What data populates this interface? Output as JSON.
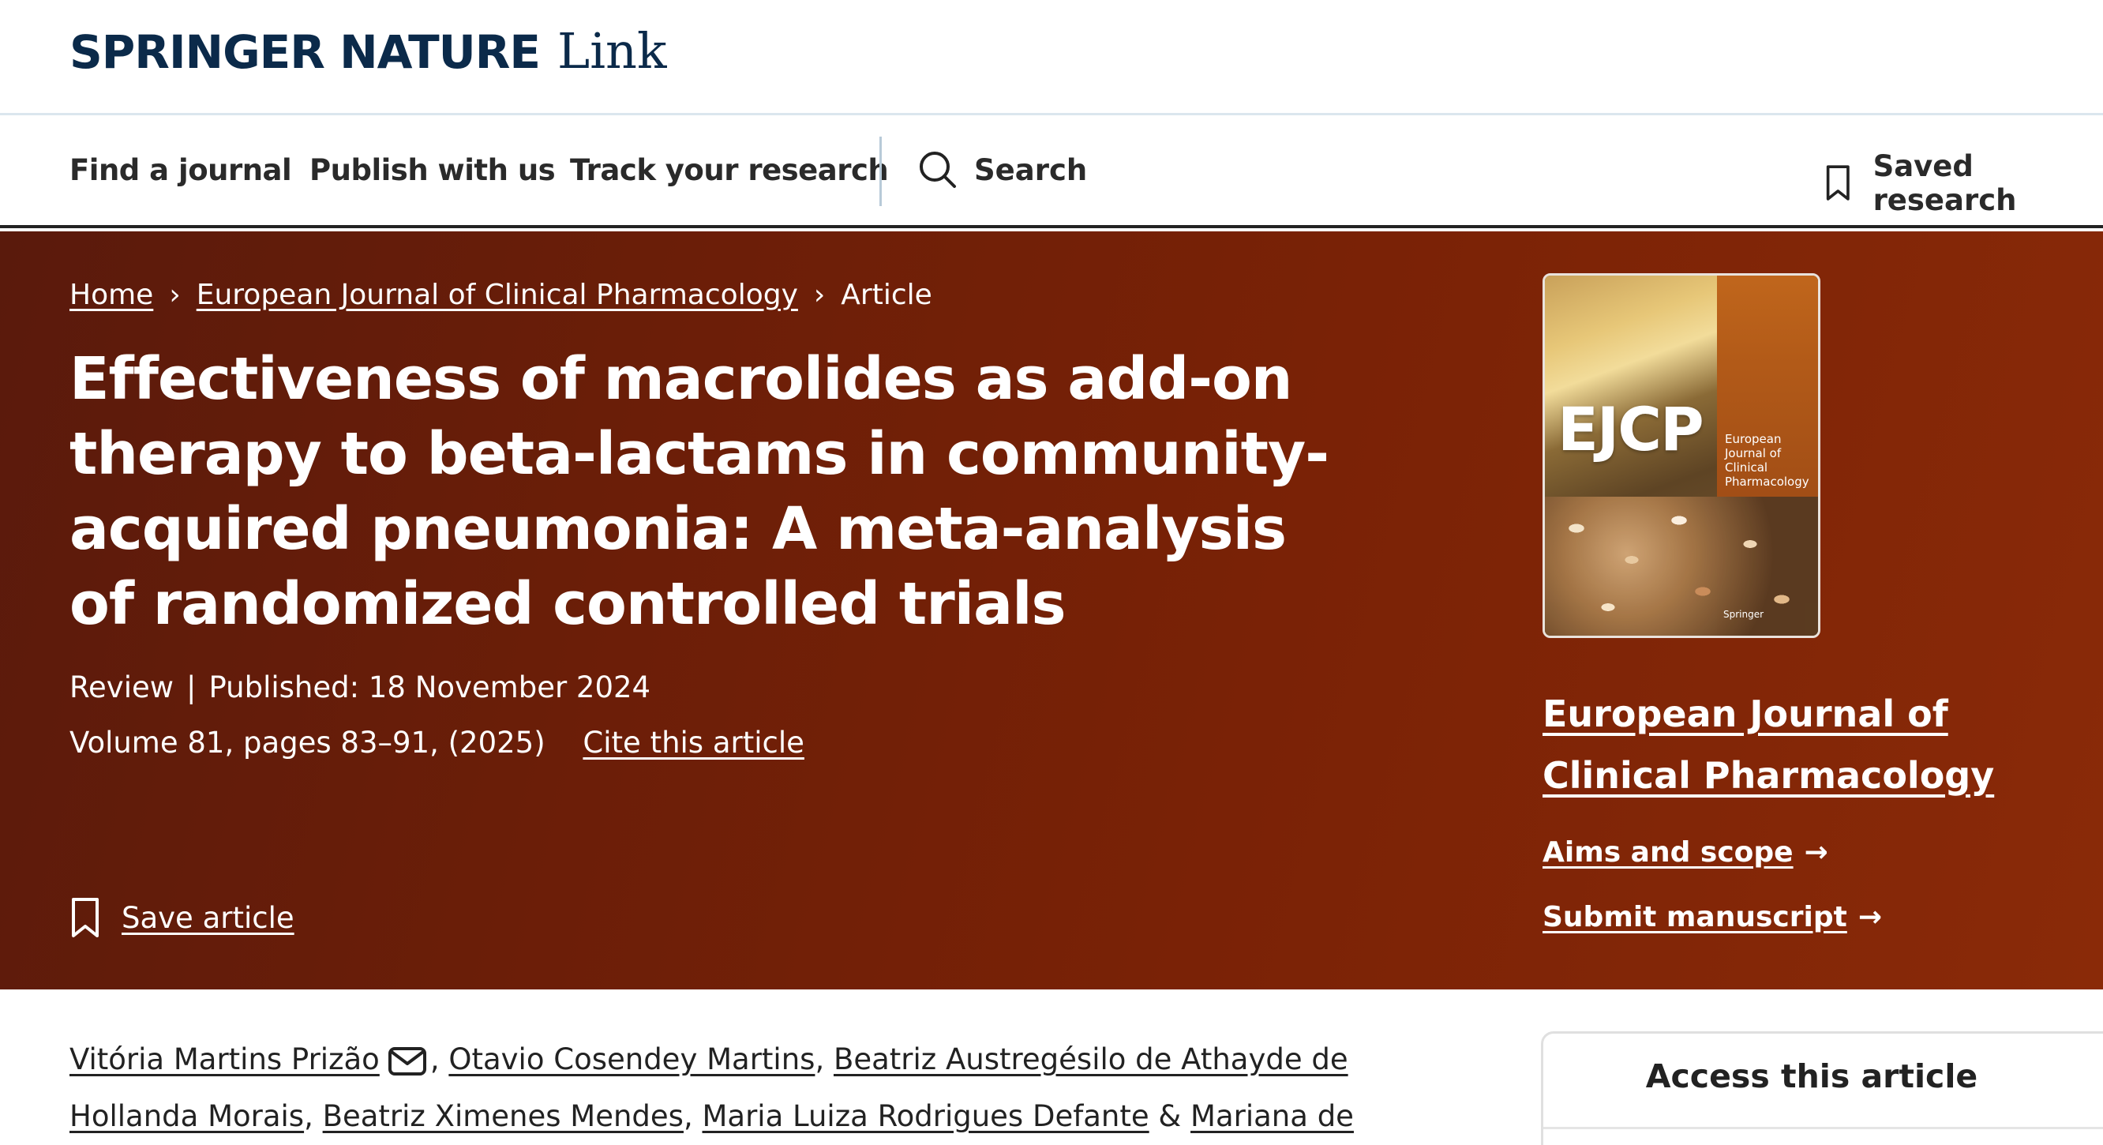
{
  "header": {
    "brand": "SPRINGER NATURE",
    "brand_suffix": "Link"
  },
  "nav": {
    "find_journal": "Find a journal",
    "publish": "Publish with us",
    "track": "Track your research",
    "search": "Search",
    "saved": "Saved research"
  },
  "breadcrumb": {
    "home": "Home",
    "journal": "European Journal of Clinical Pharmacology",
    "current": "Article"
  },
  "article": {
    "title": "Effectiveness of macrolides as add-on therapy to beta-lactams in community-acquired pneumonia: A meta-analysis of randomized controlled trials",
    "type": "Review",
    "published": "Published: 18 November 2024",
    "volume": "Volume 81, pages 83–91, (2025)",
    "cite": "Cite this article",
    "save": "Save article"
  },
  "journal": {
    "cover_abbrev": "EJCP",
    "cover_name": "European Journal of Clinical Pharmacology",
    "cover_publisher": "Springer",
    "name": "European Journal of Clinical Pharmacology",
    "aims": "Aims and scope",
    "submit": "Submit manuscript"
  },
  "authors": {
    "a1": "Vitória Martins Prizão",
    "a2": "Otavio Cosendey Martins",
    "a3": "Beatriz Austregésilo de Athayde de Hollanda Morais",
    "a4": "Beatriz Ximenes Mendes",
    "a5": "Maria Luiza Rodrigues Defante",
    "amp": "&",
    "a6": "Mariana de Moura Souza"
  },
  "access": {
    "title": "Access this article"
  },
  "colors": {
    "hero": "#6b1e08",
    "brand": "#0b2a4a"
  }
}
